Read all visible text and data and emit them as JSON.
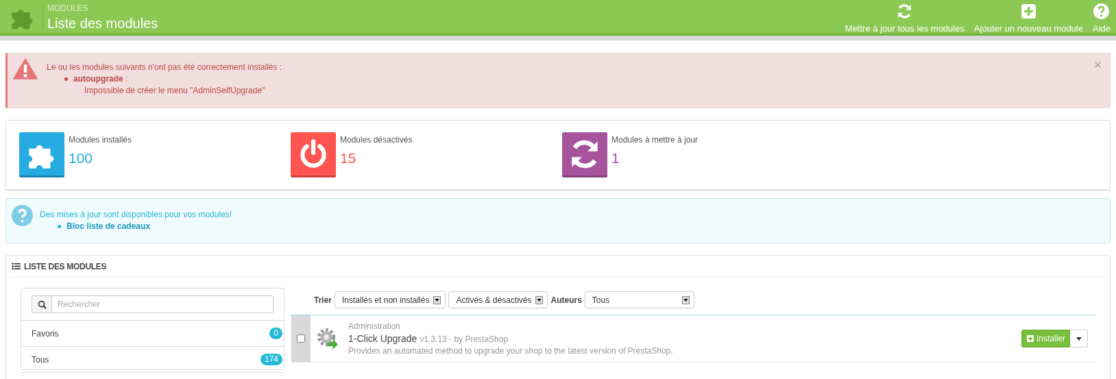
{
  "header": {
    "section": "MODULES",
    "title": "Liste des modules",
    "actions": [
      {
        "kind": "refresh",
        "label": "Mettre à jour tous les modules"
      },
      {
        "kind": "add",
        "label": "Ajouter un nouveau module"
      },
      {
        "kind": "help",
        "label": "Aide"
      }
    ]
  },
  "error_alert": {
    "message": "Le ou les modules suivants n'ont pas été correctement installés :",
    "close": "×",
    "items": [
      {
        "module": "autoupgrade",
        "separator": " :",
        "detail": "Impossible de créer le menu \"AdminSelfUpgrade\""
      }
    ]
  },
  "stats": [
    {
      "kind": "puzzle",
      "label": "Modules installés",
      "value": "100",
      "color": "#25aae1"
    },
    {
      "kind": "power",
      "label": "Modules désactivés",
      "value": "15",
      "color": "#ff5450"
    },
    {
      "kind": "refresh",
      "label": "Modules à mettre à jour",
      "value": "1",
      "color": "#a6559d"
    }
  ],
  "info_alert": {
    "message": "Des mises à jour sont disponibles pour vos modules!",
    "items": [
      "Bloc liste de cadeaux"
    ]
  },
  "module_list": {
    "title": "LISTE DES MODULES",
    "search": {
      "placeholder": "Rechercher"
    },
    "categories": [
      {
        "label": "Favoris",
        "count": "0"
      },
      {
        "label": "Tous",
        "count": "174"
      }
    ],
    "filters": [
      {
        "label": "Trier",
        "value": "Installés et non installés"
      },
      {
        "value": "Activés & désactivés"
      },
      {
        "label": "Auteurs",
        "value": "Tous"
      }
    ],
    "modules": [
      {
        "category": "Administration",
        "name": "1-Click Upgrade",
        "meta": "v1.3.13 - by PrestaShop",
        "description": "Provides an automated method to upgrade your shop to the latest version of PrestaShop.",
        "checked": false,
        "action": "Installer"
      }
    ]
  }
}
